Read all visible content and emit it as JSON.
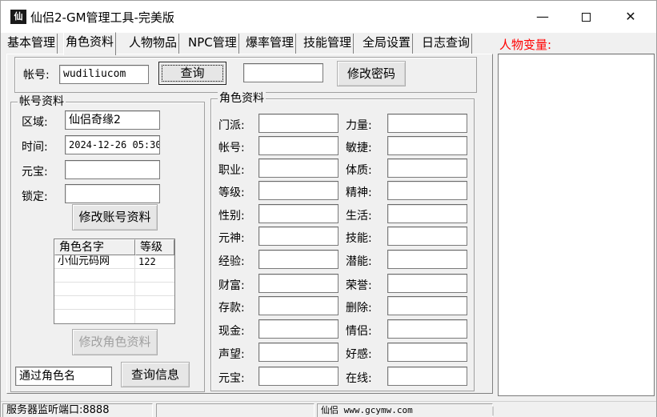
{
  "window": {
    "title": "仙侣2-GM管理工具-完美版",
    "icon": "app-logo-icon",
    "icon_glyph": "仙"
  },
  "tabs": [
    {
      "label": "基本管理",
      "active": false
    },
    {
      "label": "角色资料",
      "active": true
    },
    {
      "label": "人物物品",
      "active": false
    },
    {
      "label": "NPC管理",
      "active": false
    },
    {
      "label": "爆率管理",
      "active": false
    },
    {
      "label": "技能管理",
      "active": false
    },
    {
      "label": "全局设置",
      "active": false
    },
    {
      "label": "日志查询",
      "active": false
    }
  ],
  "variables_label": "人物变量:",
  "account_bar": {
    "account_label": "帐号:",
    "account_value": "wudiliucom",
    "query_button": "查询",
    "password_value": "",
    "change_password_button": "修改密码"
  },
  "account_info": {
    "group_title": "帐号资料",
    "region_label": "区域:",
    "region_value": "仙侣奇缘2",
    "time_label": "时间:",
    "time_value": "2024-12-26 05:30",
    "yuanbao_label": "元宝:",
    "yuanbao_value": "",
    "lock_label": "锁定:",
    "lock_value": "",
    "modify_button": "修改账号资料"
  },
  "role_list": {
    "columns": [
      "角色名字",
      "等级"
    ],
    "rows": [
      [
        "小仙元码网",
        "122"
      ]
    ]
  },
  "modify_role_button": "修改角色资料",
  "search": {
    "input_value": "通过角色名",
    "button": "查询信息"
  },
  "role_info": {
    "group_title": "角色资料",
    "left_fields": [
      {
        "label": "门派:",
        "value": ""
      },
      {
        "label": "帐号:",
        "value": ""
      },
      {
        "label": "职业:",
        "value": ""
      },
      {
        "label": "等级:",
        "value": ""
      },
      {
        "label": "性别:",
        "value": ""
      },
      {
        "label": "元神:",
        "value": ""
      },
      {
        "label": "经验:",
        "value": ""
      },
      {
        "label": "财富:",
        "value": ""
      },
      {
        "label": "存款:",
        "value": ""
      },
      {
        "label": "现金:",
        "value": ""
      },
      {
        "label": "声望:",
        "value": ""
      },
      {
        "label": "元宝:",
        "value": ""
      }
    ],
    "right_fields": [
      {
        "label": "力量:",
        "value": ""
      },
      {
        "label": "敏捷:",
        "value": ""
      },
      {
        "label": "体质:",
        "value": ""
      },
      {
        "label": "精神:",
        "value": ""
      },
      {
        "label": "生活:",
        "value": ""
      },
      {
        "label": "技能:",
        "value": ""
      },
      {
        "label": "潜能:",
        "value": ""
      },
      {
        "label": "荣誉:",
        "value": ""
      },
      {
        "label": "删除:",
        "value": ""
      },
      {
        "label": "情侣:",
        "value": ""
      },
      {
        "label": "好感:",
        "value": ""
      },
      {
        "label": "在线:",
        "value": ""
      }
    ]
  },
  "statusbar": {
    "port_text": "服务器监听端口:8888",
    "middle_text": "",
    "site_text": "仙侣  www.gcymw.com"
  }
}
